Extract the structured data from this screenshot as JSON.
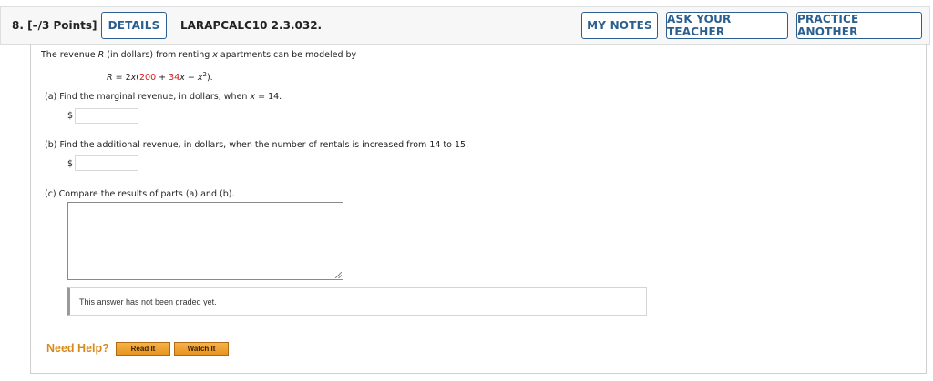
{
  "header": {
    "question_label": "8.  [–/3 Points]",
    "details_label": "DETAILS",
    "code": "LARAPCALC10 2.3.032.",
    "my_notes_label": "MY NOTES",
    "ask_teacher_label": "ASK YOUR TEACHER",
    "practice_label": "PRACTICE ANOTHER"
  },
  "problem": {
    "intro_pre": "The revenue ",
    "intro_var_R": "R",
    "intro_mid": " (in dollars) from renting ",
    "intro_var_x": "x",
    "intro_post": " apartments can be modeled by",
    "eq_lhs": "R",
    "eq_eq": " = 2",
    "eq_x": "x",
    "eq_open": "(",
    "eq_200": "200",
    "eq_plus": " + ",
    "eq_34": "34",
    "eq_x2": "x",
    "eq_minus": " − ",
    "eq_x3": "x",
    "eq_sq": "2",
    "eq_close": ")."
  },
  "parts": {
    "a": {
      "label": "(a)   Find the marginal revenue, in dollars, when ",
      "var": "x",
      "label_end": " = 14.",
      "currency": "$",
      "value": ""
    },
    "b": {
      "label": "(b)   Find the additional revenue, in dollars, when the number of rentals is increased from 14 to 15.",
      "currency": "$",
      "value": ""
    },
    "c": {
      "label": "(c)   Compare the results of parts (a) and (b).",
      "value": ""
    }
  },
  "graded_notice": "This answer has not been graded yet.",
  "help": {
    "label": "Need Help?",
    "read_label": "Read It",
    "watch_label": "Watch It"
  },
  "colors": {
    "accent": "#2b5f8f",
    "red": "#d0191d",
    "help_orange": "#d98a1c"
  }
}
